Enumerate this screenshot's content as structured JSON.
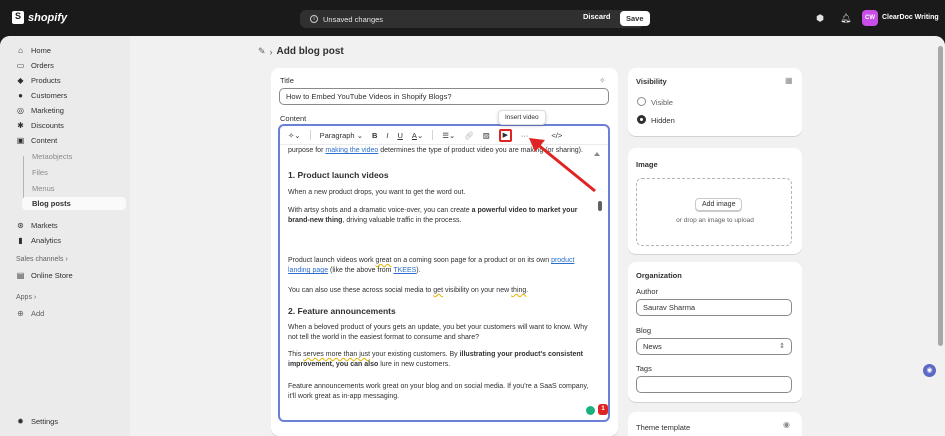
{
  "topbar": {
    "logo": "shopify",
    "unsaved": "Unsaved changes",
    "discard": "Discard",
    "save": "Save",
    "avatar_initials": "CW",
    "store_name": "ClearDoc Writing"
  },
  "sidebar": {
    "items": [
      {
        "label": "Home",
        "icon": "home-icon"
      },
      {
        "label": "Orders",
        "icon": "orders-icon"
      },
      {
        "label": "Products",
        "icon": "tag-icon"
      },
      {
        "label": "Customers",
        "icon": "person-icon"
      },
      {
        "label": "Marketing",
        "icon": "target-icon"
      },
      {
        "label": "Discounts",
        "icon": "discount-icon"
      },
      {
        "label": "Content",
        "icon": "content-icon"
      }
    ],
    "content_sub": [
      "Metaobjects",
      "Files",
      "Menus",
      "Blog posts"
    ],
    "markets": "Markets",
    "analytics": "Analytics",
    "sales_channels": "Sales channels",
    "online_store": "Online Store",
    "apps": "Apps",
    "add": "Add",
    "settings": "Settings"
  },
  "page": {
    "title": "Add blog post"
  },
  "editor_card": {
    "title_label": "Title",
    "title_value": "How to Embed YouTube Videos in Shopify Blogs?",
    "content_label": "Content",
    "toolbar": {
      "paragraph": "Paragraph",
      "bold": "B",
      "italic": "I",
      "underline": "U",
      "color": "A"
    },
    "tooltip": "Insert video",
    "body": {
      "p0_pre": "purpose for ",
      "p0_link": "making the video",
      "p0_post": " determines the type of product video you are making (or sharing).",
      "h1": "1. Product launch videos",
      "p1": "When a new product drops, you want to get the word out.",
      "p2_pre": "With artsy shots and a dramatic voice-over, you can create ",
      "p2_bold": "a powerful video to market your brand-new thing",
      "p2_post": ", driving valuable traffic in the process.",
      "p3_a": "Product launch videos work ",
      "p3_b": "great",
      "p3_c": " on a coming soon page for a product or on its own ",
      "p3_link1": "product landing page",
      "p3_d": " (like the above from ",
      "p3_link2": "TKEES",
      "p3_e": ").",
      "p4_a": "You can also use these across social media to ",
      "p4_b": "get",
      "p4_c": " visibility on your new ",
      "p4_d": "thing",
      "p4_e": ".",
      "h2": "2. Feature announcements",
      "p5": "When a beloved product of yours gets an update, you bet your customers will want to know. Why not tell the world in the easiest format to consume and share?",
      "p6_a": "This ",
      "p6_b": "serves more than just",
      "p6_c": " your existing customers. By ",
      "p6_bold1": "illustrating your product's consistent improvement, you can also",
      "p6_d": " lure in new customers.",
      "p7": "Feature announcements work great on your blog and on social media. If you're a SaaS company, it'll work great as in-app messaging."
    },
    "badge_count": "1"
  },
  "visibility": {
    "title": "Visibility",
    "visible": "Visible",
    "hidden": "Hidden",
    "selected": "Hidden"
  },
  "image": {
    "title": "Image",
    "add_button": "Add image",
    "hint": "or drop an image to upload"
  },
  "organization": {
    "title": "Organization",
    "author_label": "Author",
    "author_value": "Saurav Sharma",
    "blog_label": "Blog",
    "blog_value": "News",
    "tags_label": "Tags",
    "tags_value": ""
  },
  "theme": {
    "title": "Theme template"
  },
  "colors": {
    "accent": "#6b7fd7",
    "highlight": "#e02424",
    "store_avatar": "#c94ee8"
  }
}
